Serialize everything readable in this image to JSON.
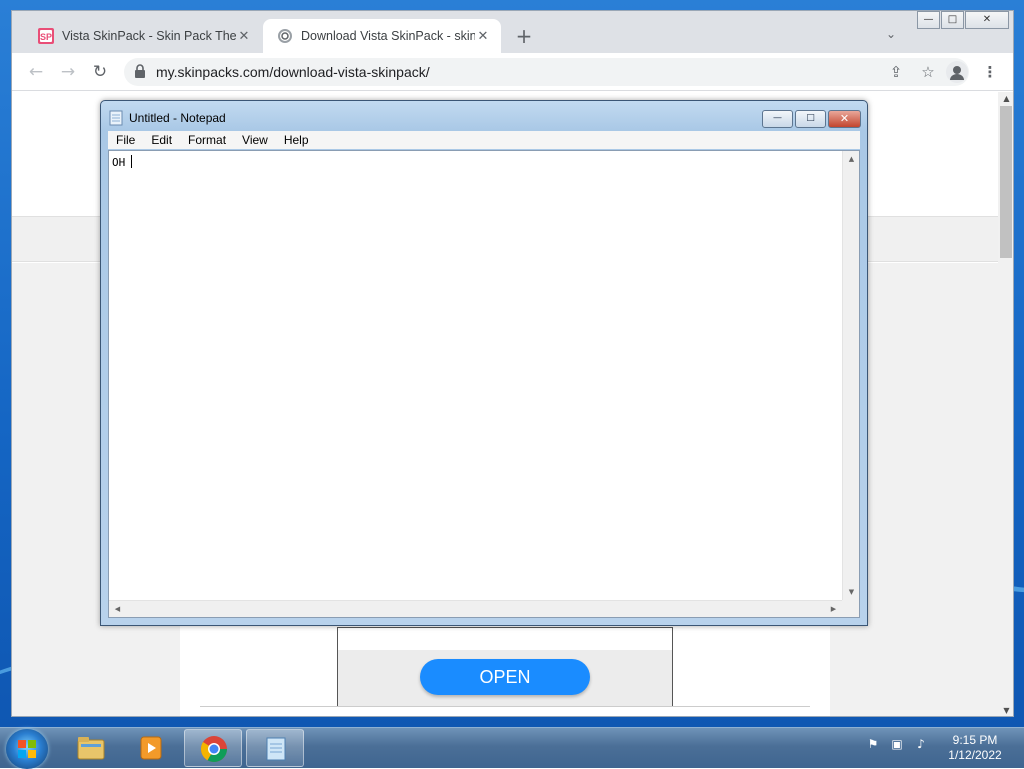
{
  "browser": {
    "tabs": [
      {
        "title": "Vista SkinPack - Skin Pack Theme",
        "favicon": "skinpack-logo-icon",
        "active": false
      },
      {
        "title": "Download Vista SkinPack - skinpack",
        "favicon": "loading-spinner-icon",
        "active": true
      }
    ],
    "new_tab": "+",
    "tab_search": "⌄",
    "url": "my.skinpacks.com/download-vista-skinpack/",
    "window_controls": {
      "minimize": "—",
      "maximize": "□",
      "close": "✕"
    }
  },
  "webpage": {
    "open_button_label": "OPEN"
  },
  "notepad": {
    "title": "Untitled - Notepad",
    "menu": [
      "File",
      "Edit",
      "Format",
      "View",
      "Help"
    ],
    "content": "OH",
    "controls": {
      "minimize": "—",
      "maximize": "□",
      "close": "✕"
    }
  },
  "taskbar": {
    "pinned": [
      "explorer-folder-icon",
      "media-player-icon",
      "chrome-icon",
      "notepad-icon"
    ],
    "active_apps": [
      "chrome-icon",
      "notepad-icon"
    ],
    "tray_icons": [
      "action-center-warning-icon",
      "network-icon",
      "volume-icon"
    ],
    "time": "9:15 PM",
    "date": "1/12/2022"
  },
  "colors": {
    "desktop_blue": "#1566c4",
    "open_button": "#1a8cff",
    "chrome_tabstrip": "#dee1e6"
  }
}
